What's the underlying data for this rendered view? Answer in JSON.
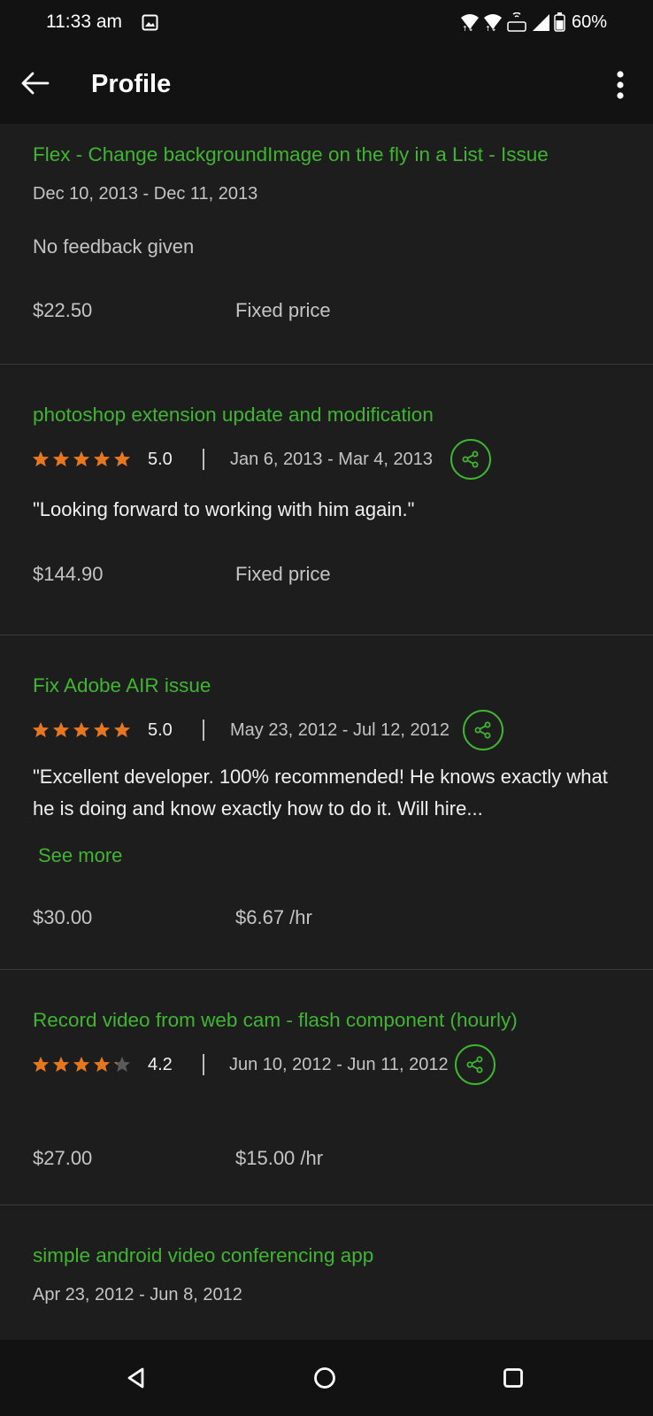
{
  "status_bar": {
    "time": "11:33 am",
    "battery": "60%",
    "icons": [
      "gallery-icon",
      "wifi-icon",
      "wifi-icon",
      "volte-icon",
      "signal-icon",
      "battery-icon"
    ]
  },
  "app_bar": {
    "title": "Profile",
    "back_icon": "arrow-left-icon",
    "more_icon": "more-vertical-icon"
  },
  "colors": {
    "accent_green": "#3fb530",
    "star_orange": "#e8761d",
    "background": "#1d1d1d",
    "bar_background": "#121212"
  },
  "jobs": [
    {
      "title": "Flex - Change backgroundImage on the fly in a List - Issue",
      "dates": "Dec 10, 2013 - Dec 11, 2013",
      "feedback": "No feedback given",
      "amount": "$22.50",
      "price_type": "Fixed price"
    },
    {
      "title": "photoshop extension update and modification",
      "rating": "5.0",
      "stars": 5,
      "dates": "Jan 6, 2013 - Mar 4, 2013",
      "quote": "\"Looking forward to working with him again.\"",
      "amount": "$144.90",
      "price_type": "Fixed price"
    },
    {
      "title": "Fix Adobe AIR issue",
      "rating": "5.0",
      "stars": 5,
      "dates": "May 23, 2012 - Jul 12, 2012",
      "quote": "\"Excellent developer. 100% recommended! He knows exactly what he is doing and know exactly how to do it. Will hire...",
      "see_more": "See more",
      "amount": "$30.00",
      "price_type": "$6.67 /hr"
    },
    {
      "title": "Record video from web cam - flash component (hourly)",
      "rating": "4.2",
      "stars": 4.2,
      "dates": "Jun 10, 2012 - Jun 11, 2012",
      "amount": "$27.00",
      "price_type": "$15.00 /hr"
    },
    {
      "title": "simple android video conferencing app",
      "dates": "Apr 23, 2012 - Jun 8, 2012"
    }
  ],
  "nav_bar": {
    "icons": [
      "nav-back-icon",
      "nav-home-icon",
      "nav-recents-icon"
    ]
  }
}
